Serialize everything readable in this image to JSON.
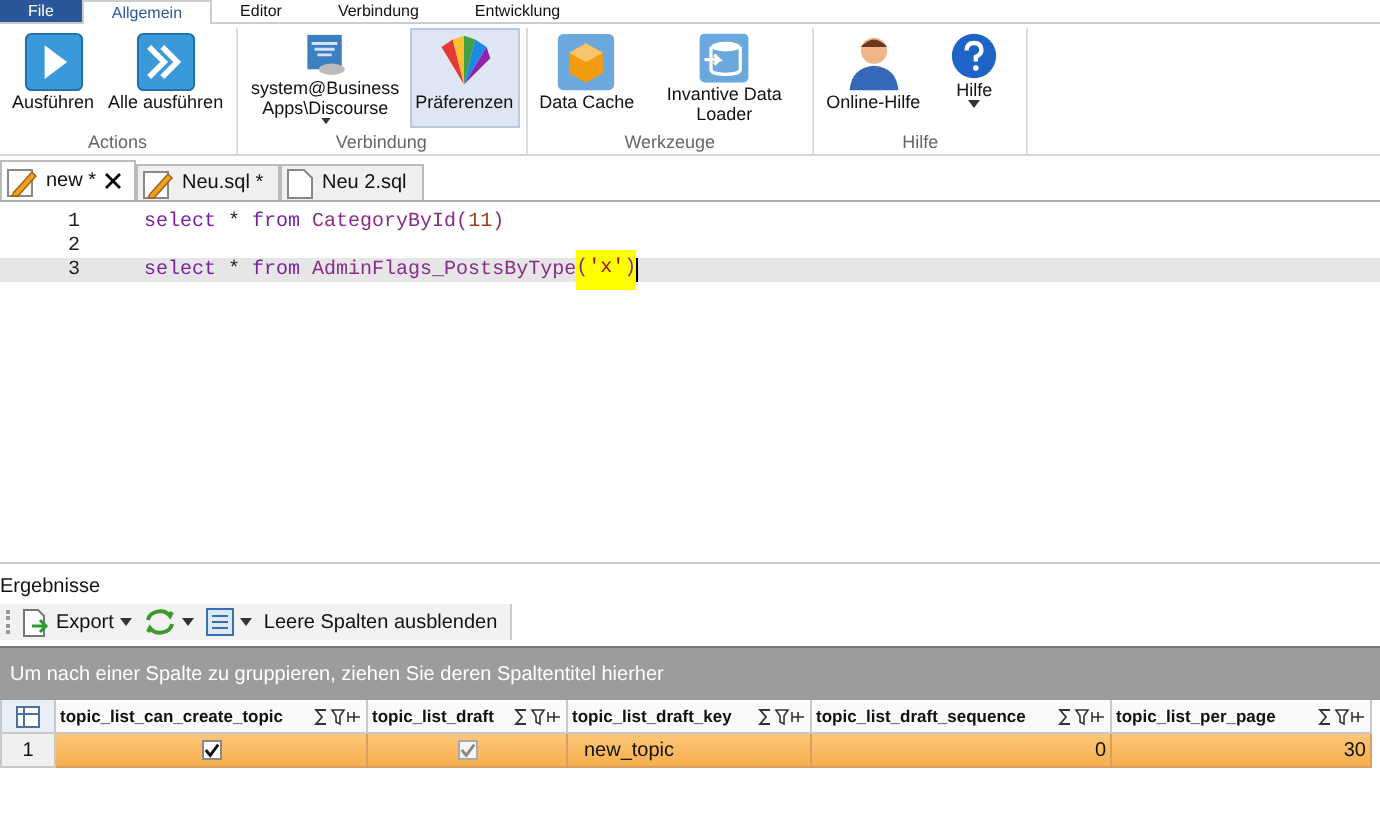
{
  "ribbon_tabs": [
    {
      "label": "File",
      "selected": false
    },
    {
      "label": "Allgemein",
      "selected": true
    },
    {
      "label": "Editor",
      "selected": false
    },
    {
      "label": "Verbindung",
      "selected": false
    },
    {
      "label": "Entwicklung",
      "selected": false
    }
  ],
  "ribbon_groups": [
    {
      "label": "Actions",
      "buttons": [
        {
          "label": "Ausführen",
          "selected": false,
          "dropdown": false
        },
        {
          "label": "Alle ausführen",
          "selected": false,
          "dropdown": false
        }
      ]
    },
    {
      "label": "Verbindung",
      "buttons": [
        {
          "label": "system@Business Apps\\Discourse",
          "selected": false,
          "dropdown": true
        },
        {
          "label": "Präferenzen",
          "selected": true,
          "dropdown": false
        }
      ]
    },
    {
      "label": "Werkzeuge",
      "buttons": [
        {
          "label": "Data Cache",
          "selected": false,
          "dropdown": false
        },
        {
          "label": "Invantive Data Loader",
          "selected": false,
          "dropdown": false
        }
      ]
    },
    {
      "label": "Hilfe",
      "buttons": [
        {
          "label": "Online-Hilfe",
          "selected": false,
          "dropdown": false
        },
        {
          "label": "Hilfe",
          "selected": false,
          "dropdown": true
        }
      ]
    }
  ],
  "doc_tabs": [
    {
      "label": "new *",
      "modified": true,
      "selected": true,
      "closable": true
    },
    {
      "label": "Neu.sql *",
      "modified": true,
      "selected": false,
      "closable": false
    },
    {
      "label": "Neu 2.sql",
      "modified": false,
      "selected": false,
      "closable": false
    }
  ],
  "editor": {
    "lines": [
      {
        "number": "1",
        "current": false,
        "segments": [
          {
            "text": "select",
            "kind": "keyword",
            "highlighted": false
          },
          {
            "text": " * ",
            "kind": "plain",
            "highlighted": false
          },
          {
            "text": "from",
            "kind": "keyword",
            "highlighted": false
          },
          {
            "text": " CategoryById(",
            "kind": "ident",
            "highlighted": false
          },
          {
            "text": "11",
            "kind": "number",
            "highlighted": false
          },
          {
            "text": ")",
            "kind": "ident",
            "highlighted": false
          }
        ]
      },
      {
        "number": "2",
        "current": false
      },
      {
        "number": "3",
        "current": true,
        "segments": [
          {
            "text": "select",
            "kind": "keyword",
            "highlighted": false
          },
          {
            "text": " * ",
            "kind": "plain",
            "highlighted": false
          },
          {
            "text": "from",
            "kind": "keyword",
            "highlighted": false
          },
          {
            "text": " AdminFlags_PostsByType",
            "kind": "ident",
            "highlighted": false
          },
          {
            "text": "(",
            "kind": "ident",
            "highlighted": true
          },
          {
            "text": "'x'",
            "kind": "string",
            "highlighted": true
          },
          {
            "text": ")",
            "kind": "ident",
            "highlighted": true
          }
        ]
      }
    ]
  },
  "results": {
    "title": "Ergebnisse",
    "toolbar": [
      {
        "label": "Export",
        "dropdown": true
      },
      {
        "dropdown": true
      },
      {
        "dropdown": true
      },
      {
        "label": "Leere Spalten ausblenden",
        "dropdown": false
      }
    ],
    "group_hint": "Um nach einer Spalte zu gruppieren, ziehen Sie deren Spaltentitel hierher",
    "table": {
      "columns": [
        "topic_list_can_create_topic",
        "topic_list_draft",
        "topic_list_draft_key",
        "topic_list_draft_sequence",
        "topic_list_per_page"
      ],
      "rows": [
        {
          "number": "1",
          "selected": true,
          "cells": [
            {
              "kind": "check",
              "checked": true,
              "disabled": false
            },
            {
              "kind": "check",
              "checked": true,
              "disabled": true
            },
            {
              "kind": "text",
              "text": "new_topic"
            },
            {
              "kind": "number",
              "text": "0"
            },
            {
              "kind": "number",
              "text": "30"
            }
          ]
        }
      ]
    }
  }
}
